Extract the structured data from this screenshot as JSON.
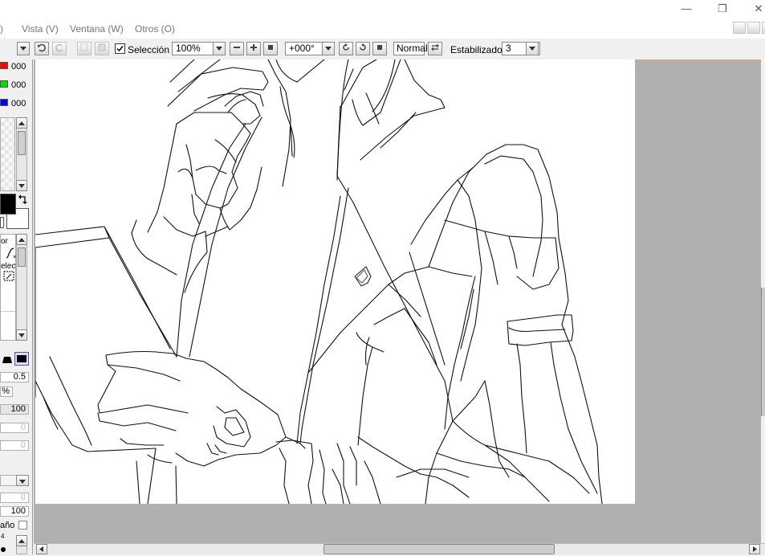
{
  "menu": {
    "items": [
      {
        "label": "Vista (V)",
        "key": "V"
      },
      {
        "label": "Ventana (W)",
        "key": "W"
      },
      {
        "label": "Otros (O)",
        "key": "O"
      }
    ],
    "cut_paren": ")"
  },
  "window_controls": {
    "minimize": "—",
    "restore": "❐",
    "close": "✕"
  },
  "toolbar": {
    "selection_label": "Selección",
    "selection_checked": true,
    "zoom_value": "100%",
    "rotation_value": "+000°",
    "blend_mode": "Normal",
    "stabilizer_label": "Estabilizador",
    "stabilizer_value": "3"
  },
  "color_panel": {
    "red_value": "000",
    "green_value": "000",
    "blue_value": "000",
    "red_color": "#ff0000",
    "green_color": "#00dd00",
    "blue_color": "#0000ff"
  },
  "tool_panel": {
    "items": [
      {
        "label": "or"
      },
      {
        "label": "elect"
      }
    ]
  },
  "brush_settings": {
    "size_value": "0.5",
    "percent_value": "%",
    "density_value": "100",
    "val_a": "0",
    "val_b": "0",
    "val_c": "0",
    "val_d": "100",
    "size_label": "año",
    "footer_num": "4"
  },
  "colors": {
    "workspace": "#b0b0b0",
    "canvas": "#ffffff",
    "accent_border": "#f0a070"
  }
}
